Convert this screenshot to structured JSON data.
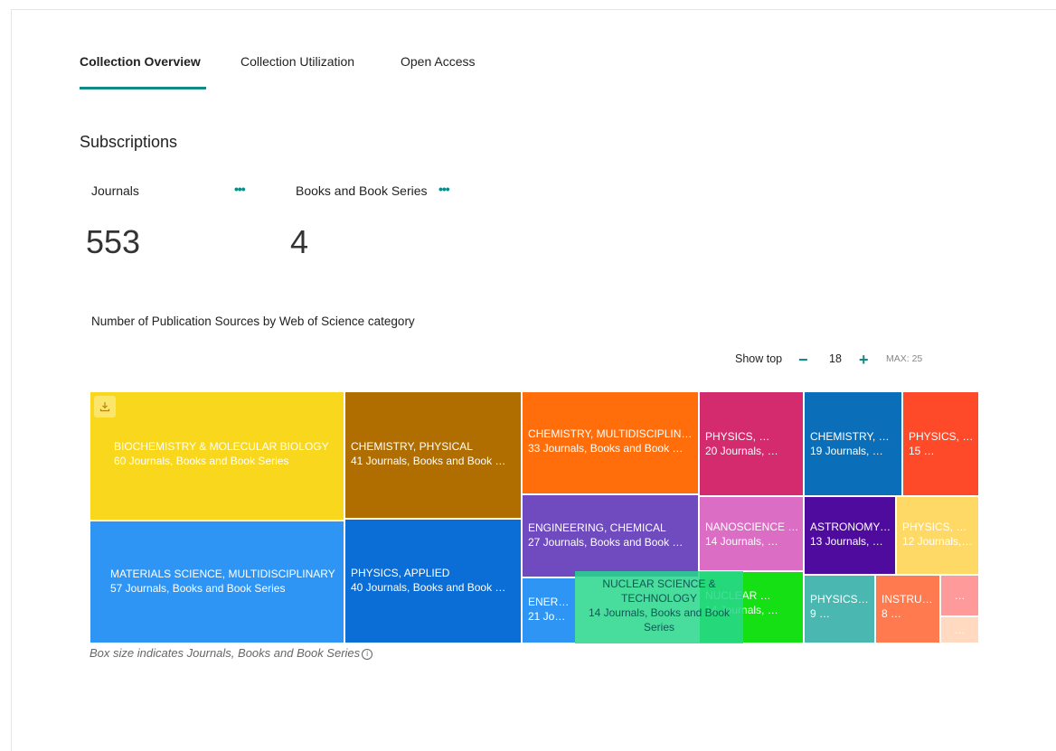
{
  "tabs": [
    {
      "label": "Collection Overview",
      "active": true
    },
    {
      "label": "Collection Utilization",
      "active": false
    },
    {
      "label": "Open Access",
      "active": false
    }
  ],
  "subscriptions": {
    "title": "Subscriptions",
    "metrics": [
      {
        "label": "Journals",
        "value": "553",
        "more_icon": "more-dots-icon"
      },
      {
        "label": "Books and Book Series",
        "value": "4",
        "more_icon": "more-dots-icon"
      }
    ]
  },
  "chart_title": "Number of Publication Sources by Web of Science category",
  "show_top": {
    "label": "Show top",
    "value": "18",
    "max_label": "MAX: 25",
    "minus": "−",
    "plus": "+"
  },
  "download_icon": "download-icon",
  "caption": "Box size indicates Journals, Books and Book Series",
  "info_icon_glyph": "i",
  "chart_data": {
    "type": "treemap",
    "size_measure": "Journals, Books and Book Series",
    "tiles": [
      {
        "name": "BIOCHEMISTRY & MOLECULAR BIOLOGY",
        "count_text": "60 Journals, Books and Book Series",
        "value": 60,
        "color": "#f9d71c"
      },
      {
        "name": "MATERIALS SCIENCE, MULTIDISCIPLINARY",
        "count_text": "57 Journals, Books and Book Series",
        "value": 57,
        "color": "#2e95f5"
      },
      {
        "name": "CHEMISTRY, PHYSICAL",
        "count_text": "41 Journals, Books and Book …",
        "value": 41,
        "color": "#b06e00"
      },
      {
        "name": "PHYSICS, APPLIED",
        "count_text": "40 Journals, Books and Book …",
        "value": 40,
        "color": "#0a6ed6"
      },
      {
        "name": "CHEMISTRY, MULTIDISCIPLINARY",
        "count_text": "33 Journals, Books and Book …",
        "value": 33,
        "color": "#ff6e0a"
      },
      {
        "name": "ENGINEERING, CHEMICAL",
        "count_text": "27 Journals, Books and Book …",
        "value": 27,
        "color": "#6f4bbf"
      },
      {
        "name": "ENERGY & FUELS",
        "count_text": "21 Journals, Books and Book Series",
        "value": 21,
        "color": "#2e95f5"
      },
      {
        "name": "PHYSICS, …",
        "count_text": "20 Journals, …",
        "value": 20,
        "color": "#d42a6e"
      },
      {
        "name": "CHEMISTRY, …",
        "count_text": "19 Journals, …",
        "value": 19,
        "color": "#0a6fb8"
      },
      {
        "name": "PHYSICS, …",
        "count_text": "15 …",
        "value": 15,
        "color": "#ff4a2a"
      },
      {
        "name": "NANOSCIENCE …",
        "count_text": "14 Journals, …",
        "value": 14,
        "color": "#db6ec4"
      },
      {
        "name": "NUCLEAR …",
        "count_text": "14 Journals, …",
        "value": 14,
        "color": "#14e014"
      },
      {
        "name": "ASTRONOMY …",
        "count_text": "13 Journals, …",
        "value": 13,
        "color": "#4e0b9e"
      },
      {
        "name": "PHYSICS, …",
        "count_text": "12 Journals,…",
        "value": 12,
        "color": "#ffd966"
      },
      {
        "name": "PHYSICS,…",
        "count_text": "9 …",
        "value": 9,
        "color": "#4ab8b0"
      },
      {
        "name": "INSTRUM…",
        "count_text": "8 …",
        "value": 8,
        "color": "#ff7a4e"
      },
      {
        "name": "…",
        "count_text": "",
        "value": null,
        "color": "#ff9a9a"
      },
      {
        "name": "…",
        "count_text": "",
        "value": null,
        "color": "#ffd9c0"
      }
    ],
    "hover_tooltip": {
      "lines": [
        "NUCLEAR SCIENCE &",
        "TECHNOLOGY",
        "14 Journals, Books and Book",
        "Series"
      ]
    }
  }
}
